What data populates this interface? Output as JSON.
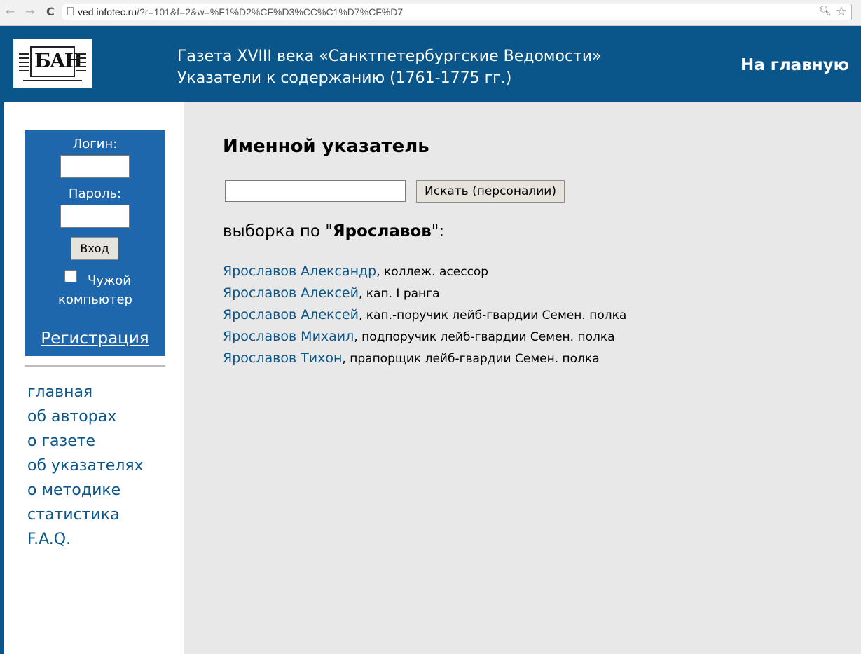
{
  "browser": {
    "url_host": "ved.infotec.ru",
    "url_path": "/?r=101&f=2&w=%F1%D2%CF%D3%CC%C1%D7%CF%D7",
    "back_glyph": "←",
    "forward_glyph": "→",
    "reload_glyph": "C"
  },
  "header": {
    "logo_text": "БАН",
    "title_line1": "Газета XVIII века «Санктпетербургские Ведомости»",
    "title_line2": "Указатели к содержанию (1761-1775 гг.)",
    "home_link": "На главную"
  },
  "login": {
    "login_label": "Логин:",
    "login_value": "",
    "password_label": "Пароль:",
    "password_value": "",
    "submit_label": "Вход",
    "foreign_computer_line1": "Чужой",
    "foreign_computer_line2": "компьютер",
    "foreign_computer_checked": false,
    "register_link": "Регистрация"
  },
  "menu": {
    "items": [
      "главная",
      "об авторах",
      "о газете",
      "об указателях",
      "о методике",
      "статистика",
      "F.A.Q."
    ]
  },
  "main": {
    "title": "Именной указатель",
    "search_value": "",
    "search_button": "Искать (персоналии)",
    "selection_prefix": "выборка по \"",
    "selection_term": "Ярославов",
    "selection_suffix": "\":",
    "results": [
      {
        "name": "Ярославов Александр",
        "desc": ", коллеж. асессор"
      },
      {
        "name": "Ярославов Алексей",
        "desc": ", кап. I ранга"
      },
      {
        "name": "Ярославов Алексей",
        "desc": ", кап.-поручик лейб-гвардии Семен. полка"
      },
      {
        "name": "Ярославов Михаил",
        "desc": ", подпоручик лейб-гвардии Семен. полка"
      },
      {
        "name": "Ярославов Тихон",
        "desc": ", прапорщик лейб-гвардии Семен. полка"
      }
    ]
  },
  "colors": {
    "header_bg": "#0a5589",
    "login_box_bg": "#1e67ad",
    "content_bg": "#e8e8e8",
    "link": "#0a5589"
  }
}
